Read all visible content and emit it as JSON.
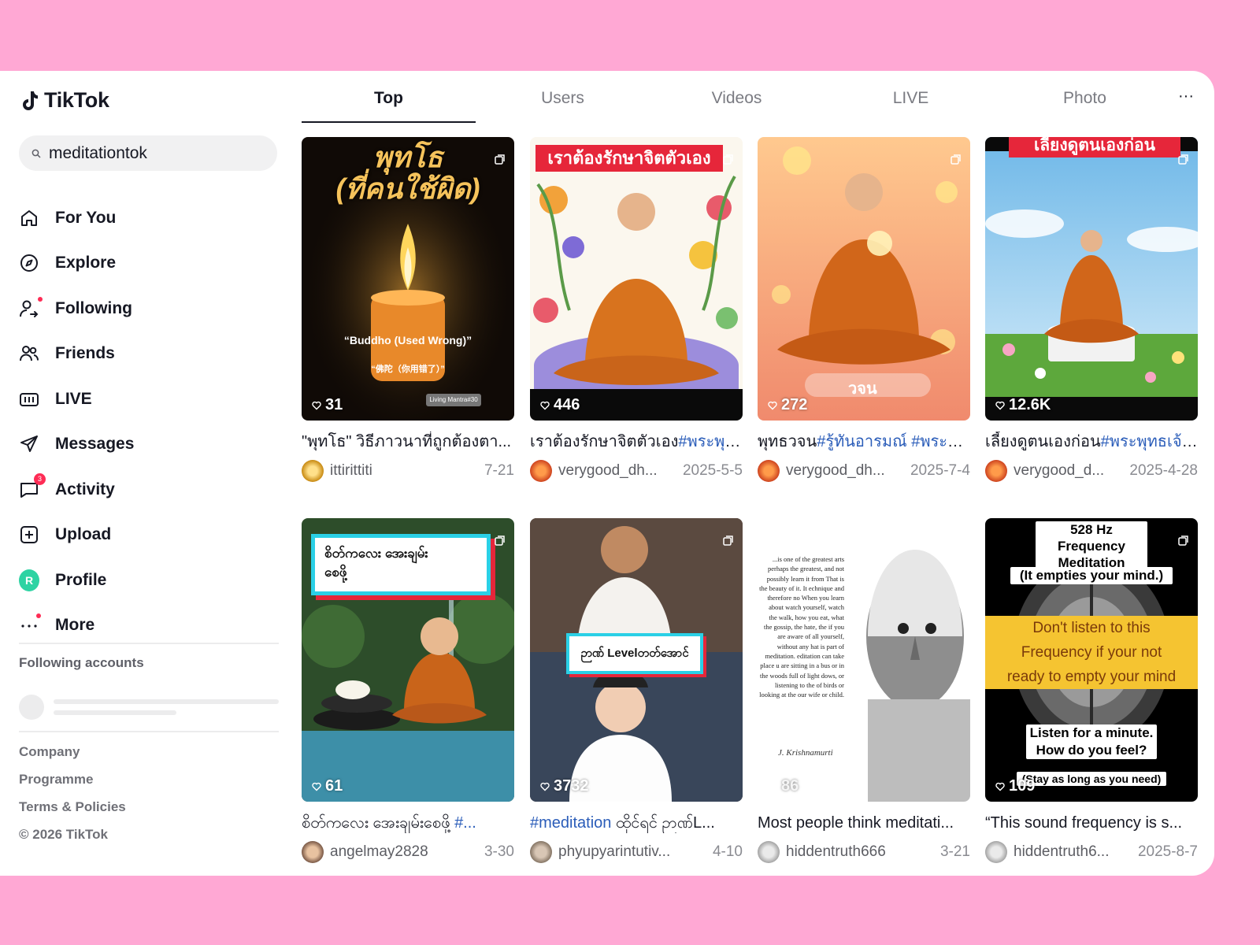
{
  "app": {
    "name": "TikTok"
  },
  "search": {
    "query": "meditationtok"
  },
  "nav": [
    {
      "label": "For You",
      "icon": "home-icon"
    },
    {
      "label": "Explore",
      "icon": "compass-icon"
    },
    {
      "label": "Following",
      "icon": "following-icon"
    },
    {
      "label": "Friends",
      "icon": "friends-icon"
    },
    {
      "label": "LIVE",
      "icon": "live-icon"
    },
    {
      "label": "Messages",
      "icon": "send-icon"
    },
    {
      "label": "Activity",
      "icon": "activity-icon",
      "badge": "3"
    },
    {
      "label": "Upload",
      "icon": "upload-icon"
    },
    {
      "label": "Profile",
      "icon": "avatar",
      "avatar_letter": "R"
    },
    {
      "label": "More",
      "icon": "more-icon"
    }
  ],
  "following_accounts": {
    "title": "Following accounts"
  },
  "footer": [
    "Company",
    "Programme",
    "Terms & Policies",
    "© 2026 TikTok"
  ],
  "tabs": [
    "Top",
    "Users",
    "Videos",
    "LIVE",
    "Photo"
  ],
  "tabs_more": "···",
  "colors": {
    "accent": "#fe2c55",
    "hashtag": "#2b5db9",
    "background": "#ffa8d4"
  },
  "videos": [
    {
      "likes": "31",
      "overlay_title": "พุทโธ\n(ที่คนใช้ผิด)",
      "overlay_sub1": "“Buddho (Used Wrong)”",
      "overlay_sub2": "“佛陀（你用错了）”",
      "overlay_tag": "Living Mantra#30",
      "caption": "\"พุทโธ\" วิธีภาวนาที่ถูกต้องตา...",
      "hashtag": "",
      "user": "ittirittiti",
      "date": "7-21"
    },
    {
      "likes": "446",
      "overlay_title": "เราต้องรักษาจิตตัวเอง",
      "caption": "เราต้องรักษาจิตตัวเอง",
      "hashtag": "#พระพุท...",
      "user": "verygood_dh...",
      "date": "2025-5-5"
    },
    {
      "likes": "272",
      "overlay_title": "วจน",
      "caption": "พุทธวจน",
      "hashtag": "#รู้ทันอารมณ์ #พระพุ...",
      "user": "verygood_dh...",
      "date": "2025-7-4"
    },
    {
      "likes": "12.6K",
      "overlay_title": "เลี้ยงดูตนเองก่อน",
      "caption": "เลี้ยงดูตนเองก่อน",
      "hashtag": "#พระพุทธเจ้า...",
      "user": "verygood_d...",
      "date": "2025-4-28"
    },
    {
      "likes": "61",
      "overlay_title": "စိတ်ကလေး အေးချမ်း\nစေဖို့",
      "caption": "စိတ်ကလေး အေးချမ်းစေဖို့ ",
      "hashtag": "#...",
      "user": "angelmay2828",
      "date": "3-30"
    },
    {
      "likes": "3732",
      "overlay_title": "ဉာဏ် Levelတတ်အောင်",
      "caption_prefix": "#meditation",
      "caption": " ထိုင်ရင် ဉာဏ်L...",
      "user": "phyupyarintutiv...",
      "date": "4-10"
    },
    {
      "likes": "86",
      "overlay_text": "...is one of the greatest arts perhaps the greatest, and not possibly learn it from That is the beauty of it. It echnique and therefore no When you learn about watch yourself, watch the walk, how you eat, what the gossip, the hate, the if you are aware of all yourself, without any hat is part of meditation. editation can take place u are sitting in a bus or in the woods full of light dows, or listening to the of birds or looking at the our wife or child.",
      "overlay_signature": "J. Krishnamurti",
      "caption": "Most people think meditati...",
      "user": "hiddentruth666",
      "date": "3-21"
    },
    {
      "likes": "109",
      "overlay_title": "528 Hz Frequency\nMeditation",
      "overlay_sub1": "(It empties your mind.)",
      "overlay_sub2": "Don't listen to this\nFrequency if your not\nready to empty your mind",
      "overlay_sub3": "Listen for a minute.\nHow do you feel?",
      "overlay_sub4": "(Stay as long as you need)",
      "caption": "“This sound frequency is s...",
      "user": "hiddentruth6...",
      "date": "2025-8-7"
    }
  ]
}
